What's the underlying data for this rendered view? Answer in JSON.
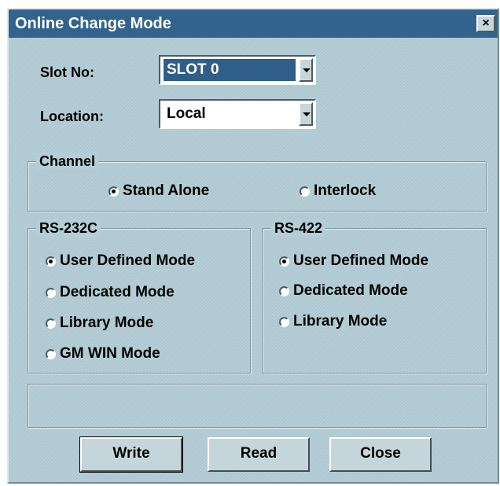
{
  "window": {
    "title": "Online Change Mode",
    "close_label": "×"
  },
  "slot": {
    "label": "Slot No:",
    "value": "SLOT 0"
  },
  "location": {
    "label": "Location:",
    "value": "Local"
  },
  "channel": {
    "title": "Channel",
    "options": [
      "Stand Alone",
      "Interlock"
    ],
    "selected": "Stand Alone"
  },
  "rs232c": {
    "title": "RS-232C",
    "options": [
      "User Defined Mode",
      "Dedicated Mode",
      "Library Mode",
      "GM WIN Mode"
    ],
    "selected": "User Defined Mode"
  },
  "rs422": {
    "title": "RS-422",
    "options": [
      "User Defined Mode",
      "Dedicated Mode",
      "Library Mode"
    ],
    "selected": "User Defined Mode"
  },
  "buttons": {
    "write": "Write",
    "read": "Read",
    "close": "Close"
  },
  "colors": {
    "titlebar": "#32638c",
    "dialog_bg": "#b4cdd6",
    "selection": "#2f5e88"
  }
}
